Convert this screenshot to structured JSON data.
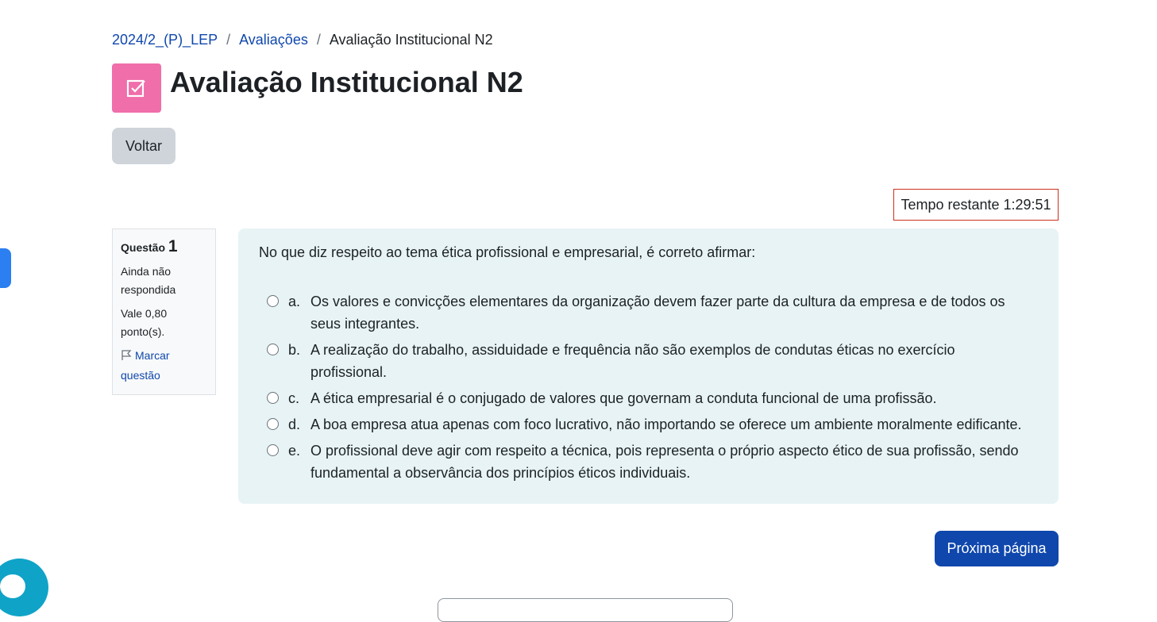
{
  "breadcrumb": {
    "course": "2024/2_(P)_LEP",
    "section": "Avaliações",
    "current": "Avaliação Institucional N2",
    "separator": "/"
  },
  "page": {
    "title": "Avaliação Institucional N2",
    "icon": "quiz-checkbox-icon",
    "icon_color": "#f06eaa"
  },
  "back_button": "Voltar",
  "timer": {
    "label": "Tempo restante 1:29:51"
  },
  "question_info": {
    "label": "Questão",
    "number": "1",
    "status": "Ainda não respondida",
    "points": "Vale 0,80 ponto(s).",
    "flag": "Marcar questão"
  },
  "question": {
    "text": "No que diz respeito ao tema ética profissional e empresarial, é correto afirmar:",
    "options": [
      {
        "letter": "a.",
        "text": "Os valores e convicções elementares da organização devem fazer parte da cultura da empresa e de todos os seus integrantes."
      },
      {
        "letter": "b.",
        "text": "A realização do trabalho, assiduidade e frequência não são exemplos de condutas éticas no exercício profissional."
      },
      {
        "letter": "c.",
        "text": "A ética empresarial é o conjugado de valores que governam a conduta funcional de uma profissão."
      },
      {
        "letter": "d.",
        "text": "A boa empresa atua apenas com foco lucrativo, não importando se oferece um ambiente moralmente edificante."
      },
      {
        "letter": "e.",
        "text": "O profissional deve agir com respeito a técnica, pois representa o próprio aspecto ético de sua profissão, sendo fundamental a observância dos princípios éticos individuais."
      }
    ]
  },
  "next_button": "Próxima página",
  "colors": {
    "primary": "#0f47ad",
    "timer_border": "#ca3120",
    "question_bg": "#e7f3f5",
    "chat": "#10a3c8"
  }
}
